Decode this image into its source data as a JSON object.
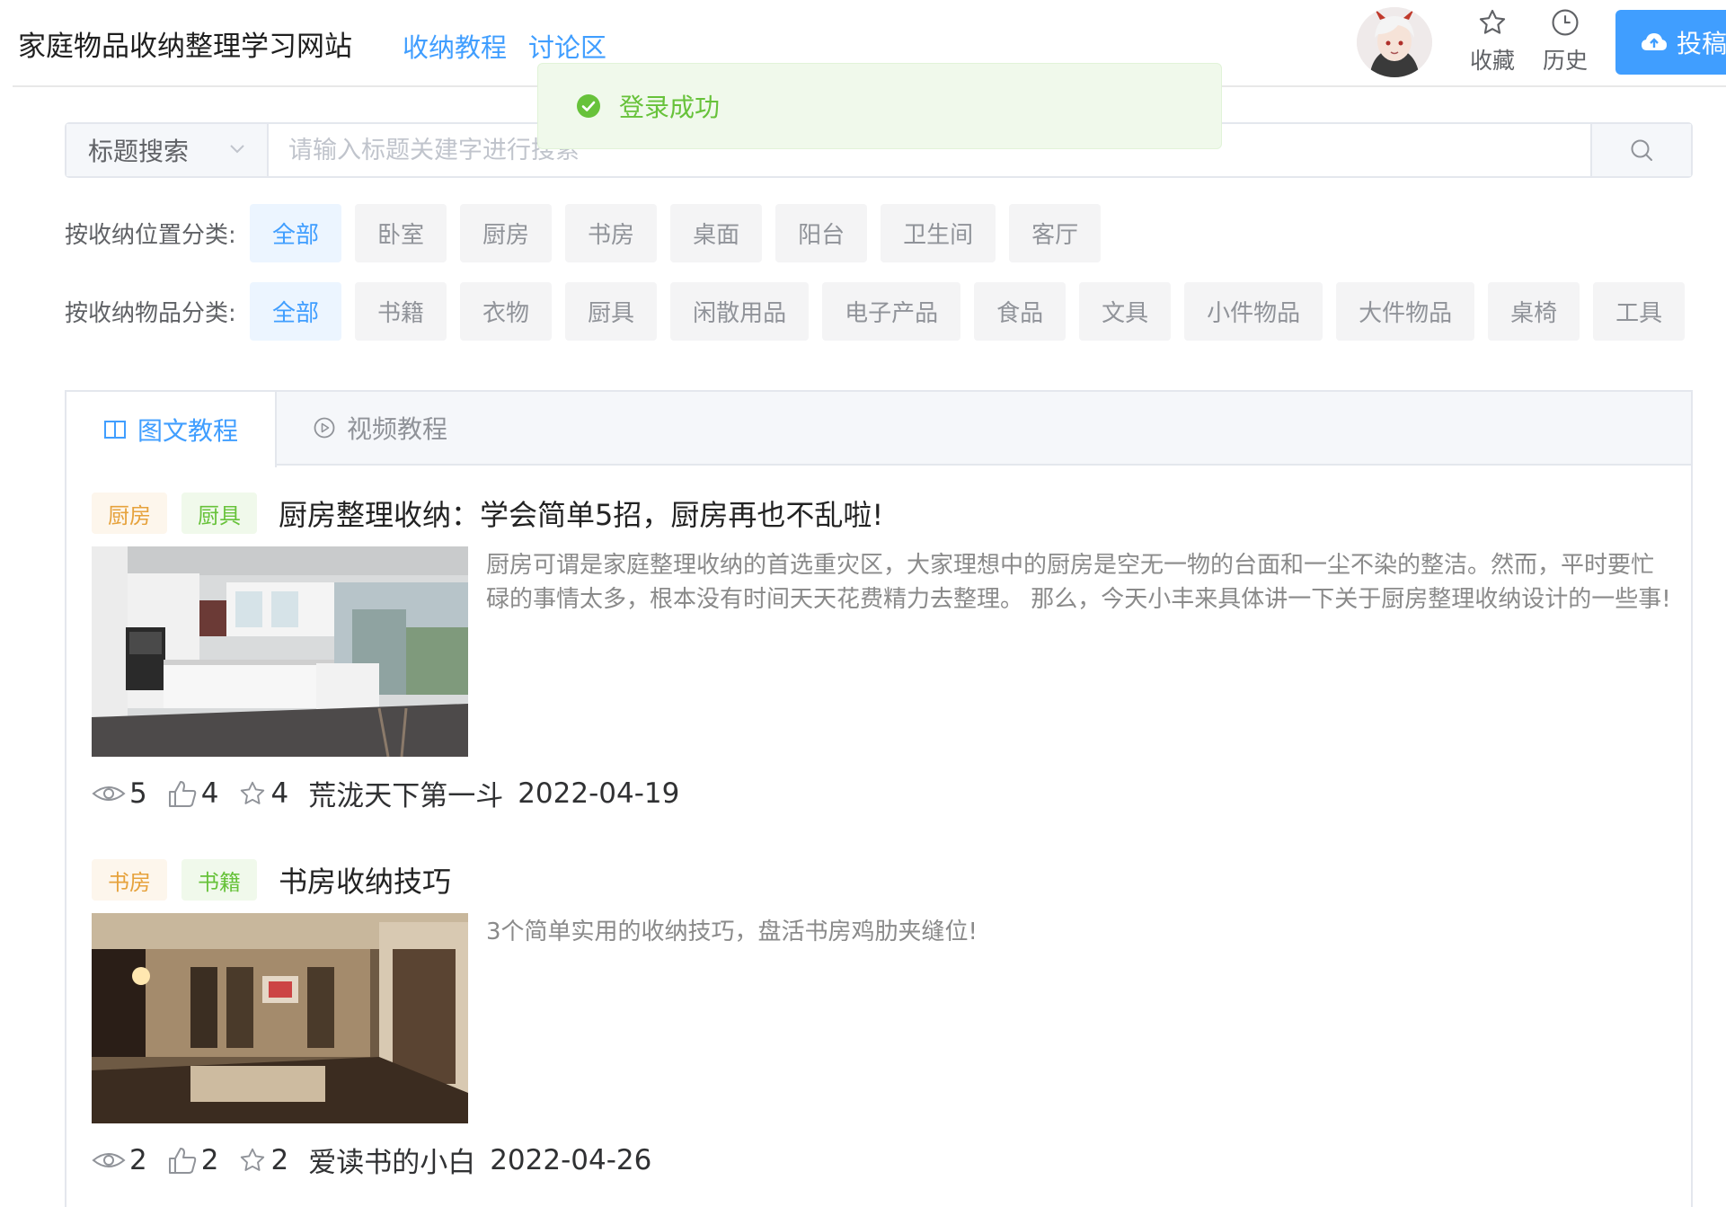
{
  "header": {
    "site_title": "家庭物品收纳整理学习网站",
    "nav": [
      "收纳教程",
      "讨论区"
    ],
    "favorites_label": "收藏",
    "history_label": "历史",
    "upload_label": "投稿"
  },
  "toast": {
    "message": "登录成功"
  },
  "search": {
    "type": "标题搜索",
    "placeholder": "请输入标题关建字进行搜索"
  },
  "filters": {
    "location": {
      "label": "按收纳位置分类:",
      "options": [
        "全部",
        "卧室",
        "厨房",
        "书房",
        "桌面",
        "阳台",
        "卫生间",
        "客厅"
      ],
      "selected": "全部"
    },
    "item": {
      "label": "按收纳物品分类:",
      "options": [
        "全部",
        "书籍",
        "衣物",
        "厨具",
        "闲散用品",
        "电子产品",
        "食品",
        "文具",
        "小件物品",
        "大件物品",
        "桌椅",
        "工具"
      ],
      "selected": "全部"
    }
  },
  "tabs": [
    {
      "label": "图文教程",
      "icon": "book-icon",
      "active": true
    },
    {
      "label": "视频教程",
      "icon": "play-circle-icon",
      "active": false
    }
  ],
  "articles": [
    {
      "tag_location": "厨房",
      "tag_item": "厨具",
      "title": "厨房整理收纳：学会简单5招，厨房再也不乱啦!",
      "description": "厨房可谓是家庭整理收纳的首选重灾区，大家理想中的厨房是空无一物的台面和一尘不染的整洁。然而，平时要忙碌的事情太多，根本没有时间天天花费精力去整理。 那么，今天小丰来具体讲一下关于厨房整理收纳设计的一些事!",
      "views": "5",
      "likes": "4",
      "favorites": "4",
      "author": "荒泷天下第一斗",
      "date": "2022-04-19",
      "image": "kitchen-photo"
    },
    {
      "tag_location": "书房",
      "tag_item": "书籍",
      "title": "书房收纳技巧",
      "description": "3个简单实用的收纳技巧，盘活书房鸡肋夹缝位!",
      "views": "2",
      "likes": "2",
      "favorites": "2",
      "author": "爱读书的小白",
      "date": "2022-04-26",
      "image": "study-room-photo"
    }
  ],
  "colors": {
    "primary": "#409eff",
    "success": "#67c23a",
    "warning": "#e6a23c"
  }
}
